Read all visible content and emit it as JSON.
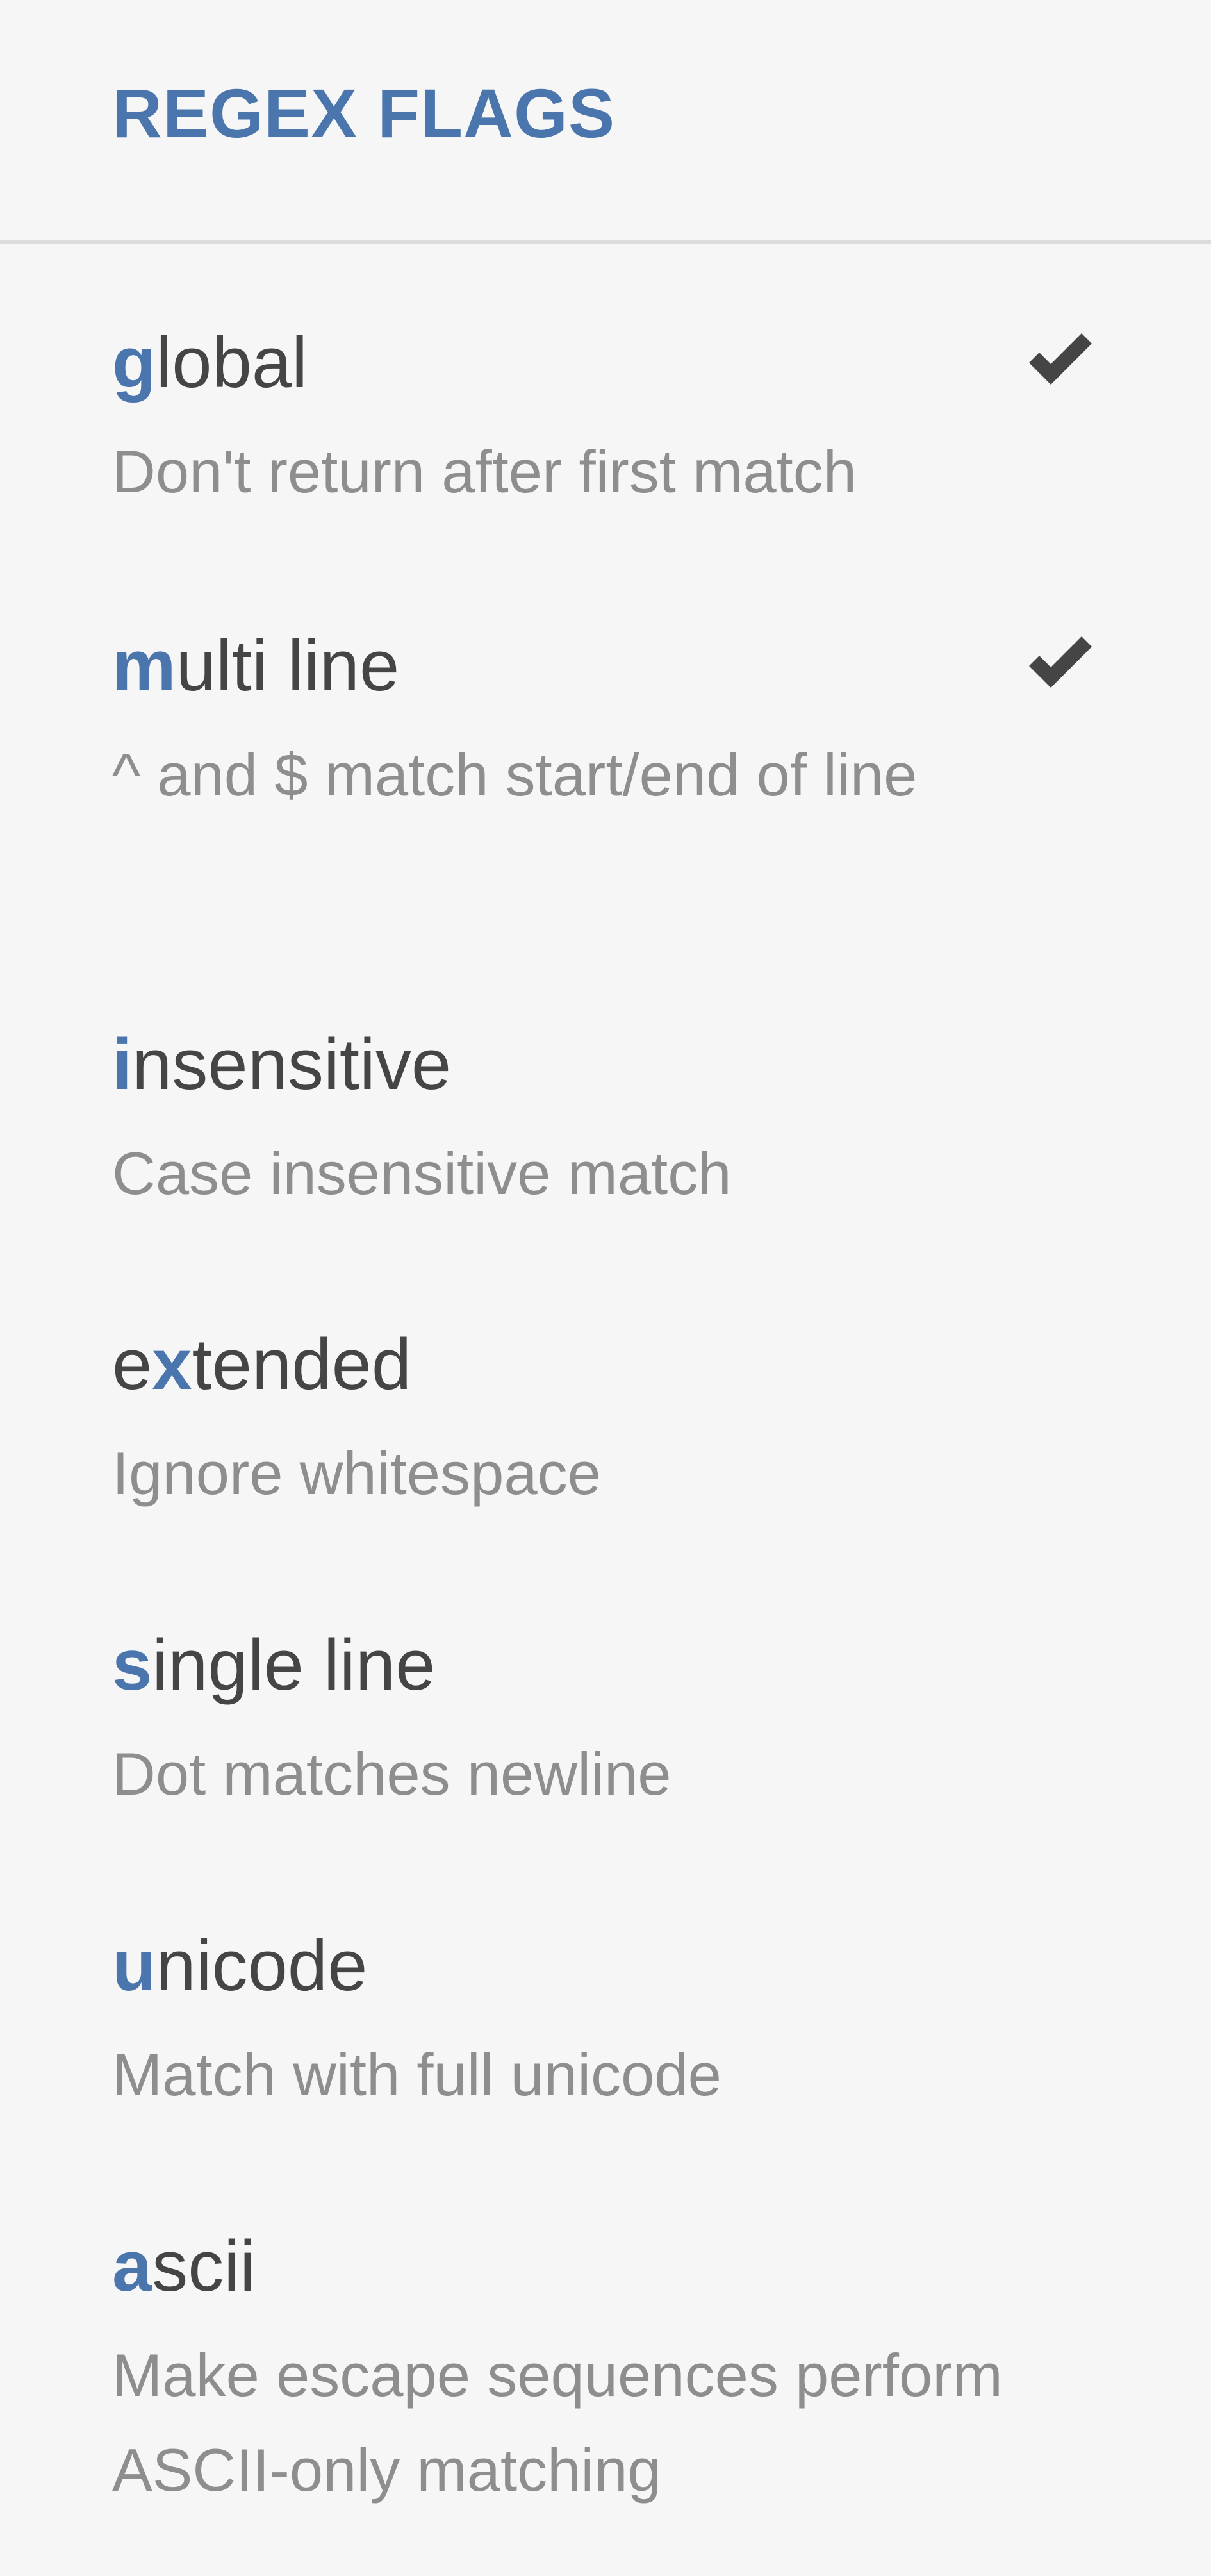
{
  "panel": {
    "title": "REGEX FLAGS"
  },
  "flags": [
    {
      "pre": "",
      "key": "g",
      "post": "lobal",
      "description": "Don't return after first match",
      "checked": true
    },
    {
      "pre": "",
      "key": "m",
      "post": "ulti line",
      "description": "^ and $ match start/end of line",
      "checked": true
    },
    {
      "pre": "",
      "key": "i",
      "post": "nsensitive",
      "description": "Case insensitive match",
      "checked": false
    },
    {
      "pre": "e",
      "key": "x",
      "post": "tended",
      "description": "Ignore whitespace",
      "checked": false
    },
    {
      "pre": "",
      "key": "s",
      "post": "ingle line",
      "description": "Dot matches newline",
      "checked": false
    },
    {
      "pre": "",
      "key": "u",
      "post": "nicode",
      "description": "Match with full unicode",
      "checked": false
    },
    {
      "pre": "",
      "key": "a",
      "post": "scii",
      "description": "Make escape sequences perform ASCII-only matching",
      "checked": false
    }
  ],
  "icons": {
    "check": "check-icon"
  },
  "colors": {
    "accent": "#4a76ad",
    "text": "#454545",
    "muted": "#8e8e8e",
    "background": "#f6f6f6",
    "divider": "#dcdcdc"
  }
}
